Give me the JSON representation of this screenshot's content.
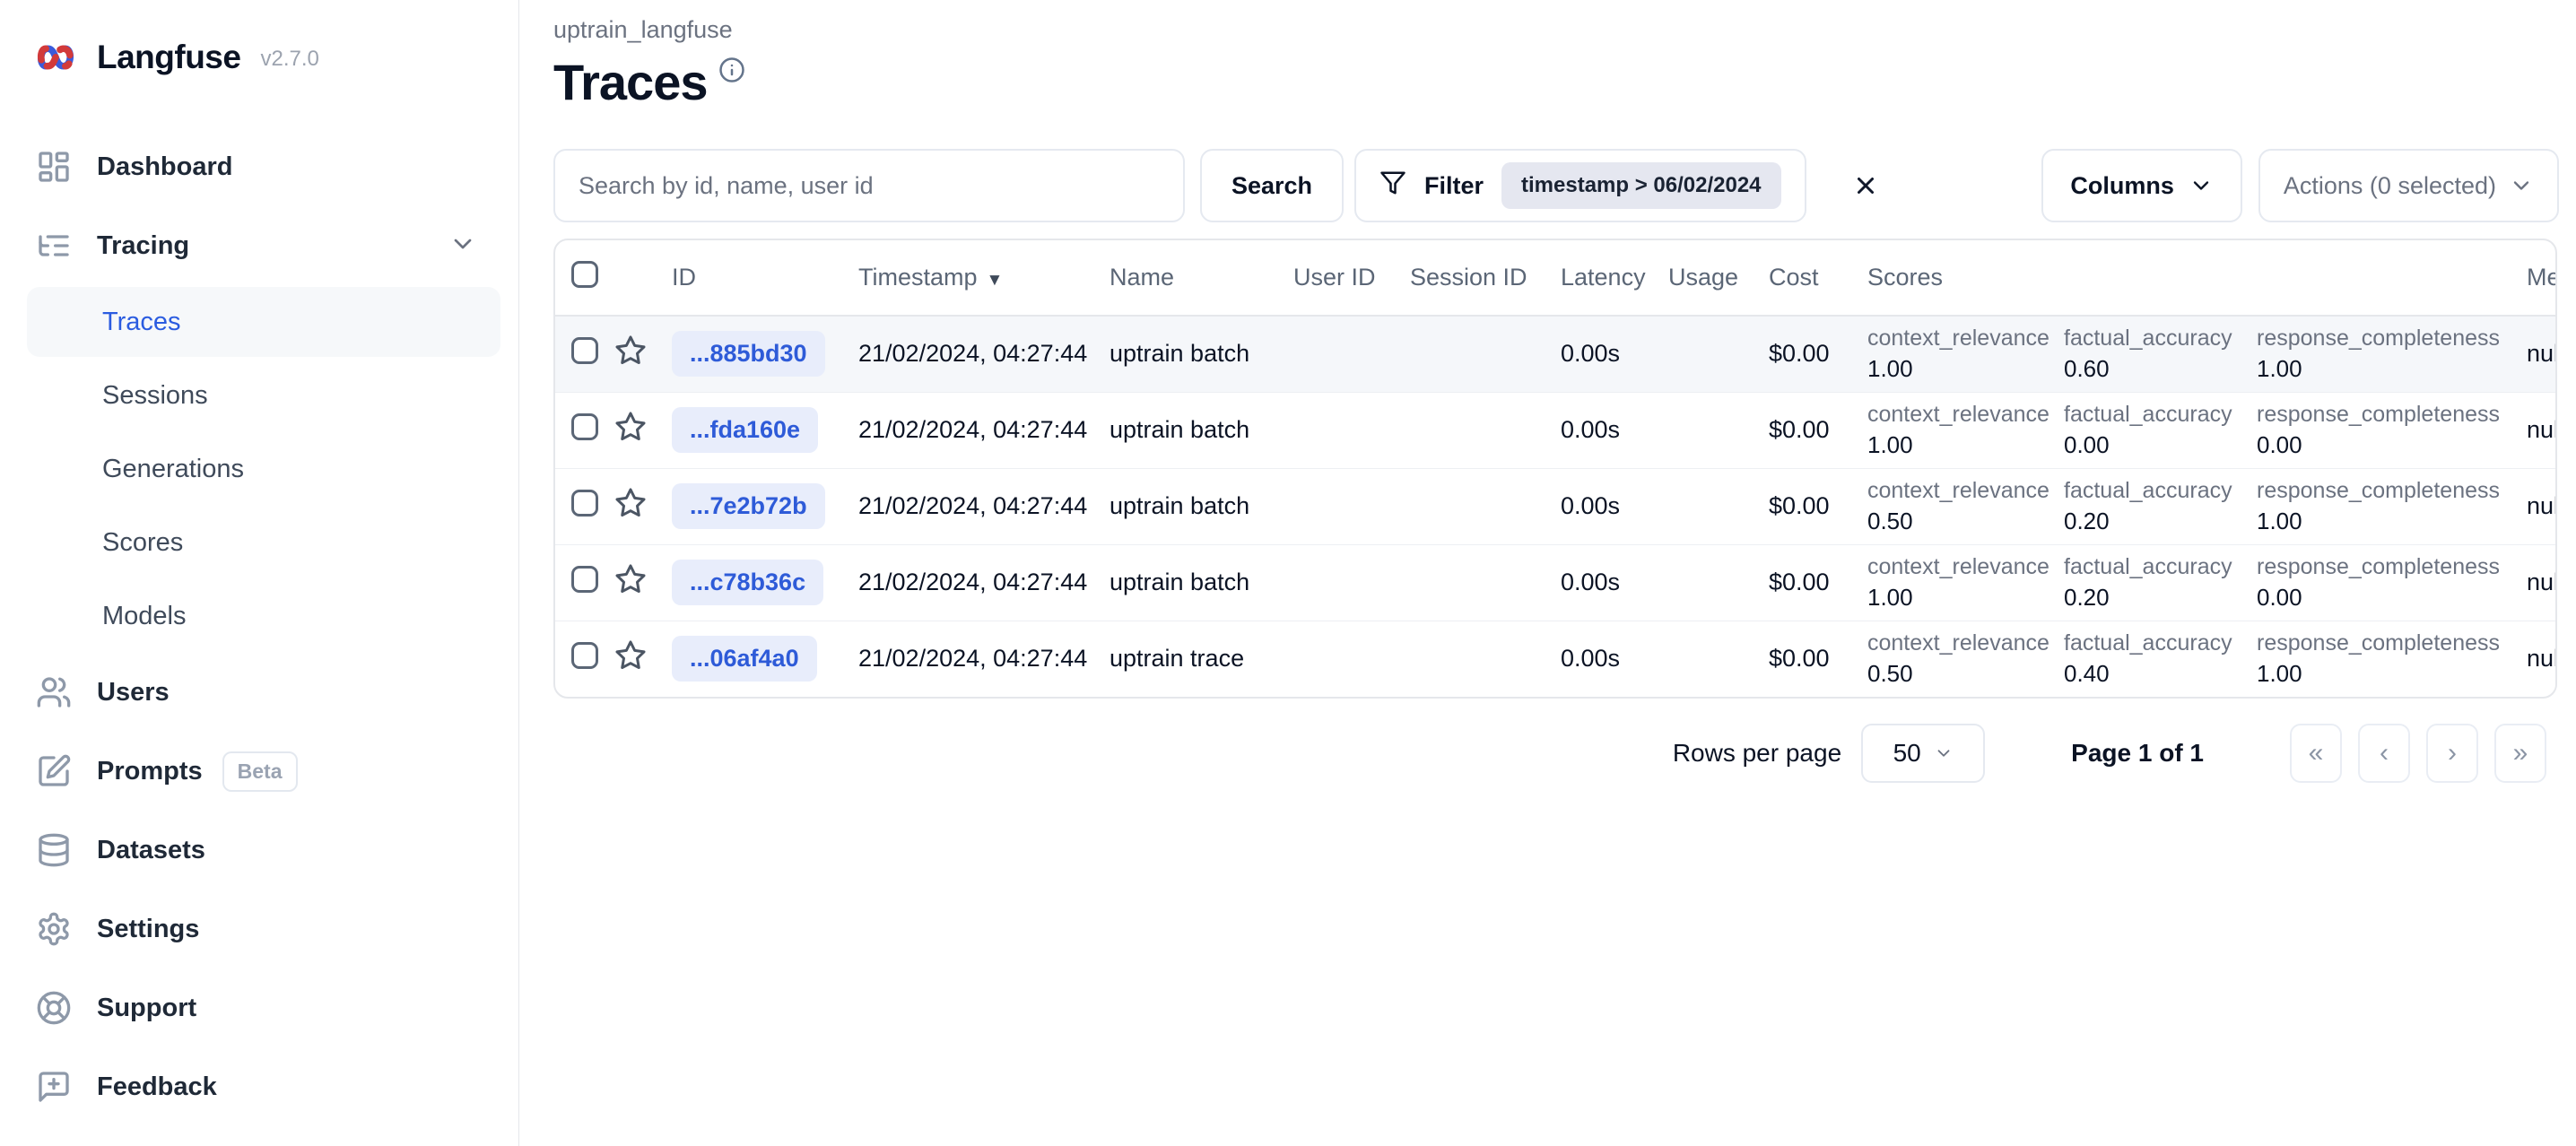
{
  "app": {
    "brand": "Langfuse",
    "version": "v2.7.0"
  },
  "icons": {
    "logo": "knot-icon",
    "dashboard": "grid-icon",
    "tracing": "list-tree-icon",
    "users": "users-icon",
    "prompts": "edit-icon",
    "datasets": "database-icon",
    "settings": "gear-icon",
    "support": "life-buoy-icon",
    "feedback": "message-plus-icon",
    "filter": "funnel-icon",
    "clear": "x-icon",
    "expand": "chevron-down-icon",
    "sort": "triangle-down-icon",
    "favorite": "star-icon",
    "info": "info-icon"
  },
  "sidebar": {
    "items": [
      {
        "label": "Dashboard",
        "type": "item"
      },
      {
        "label": "Tracing",
        "type": "item",
        "chevron": true
      },
      {
        "label": "Traces",
        "type": "sub",
        "active": true
      },
      {
        "label": "Sessions",
        "type": "sub"
      },
      {
        "label": "Generations",
        "type": "sub"
      },
      {
        "label": "Scores",
        "type": "sub"
      },
      {
        "label": "Models",
        "type": "sub"
      },
      {
        "label": "Users",
        "type": "item"
      },
      {
        "label": "Prompts",
        "type": "item",
        "badge": "Beta"
      },
      {
        "label": "Datasets",
        "type": "item"
      },
      {
        "label": "Settings",
        "type": "item"
      },
      {
        "label": "Support",
        "type": "item"
      },
      {
        "label": "Feedback",
        "type": "item"
      }
    ]
  },
  "header": {
    "project": "uptrain_langfuse",
    "title": "Traces"
  },
  "toolbar": {
    "search_placeholder": "Search by id, name, user id",
    "search_button": "Search",
    "filter_label": "Filter",
    "filter_chip": "timestamp > 06/02/2024",
    "columns_label": "Columns",
    "actions_label": "Actions (0 selected)"
  },
  "table": {
    "columns": [
      "ID",
      "Timestamp",
      "Name",
      "User ID",
      "Session ID",
      "Latency",
      "Usage",
      "Cost",
      "Scores",
      "Metadata"
    ],
    "sorted_column": "Timestamp",
    "sort_indicator": "▼",
    "rows": [
      {
        "id": "...885bd30",
        "timestamp": "21/02/2024, 04:27:44",
        "name": "uptrain batch",
        "user_id": "",
        "session_id": "",
        "latency": "0.00s",
        "usage": "",
        "cost": "$0.00",
        "scores": [
          {
            "name": "context_relevance",
            "value": "1.00"
          },
          {
            "name": "factual_accuracy",
            "value": "0.60"
          },
          {
            "name": "response_completeness",
            "value": "1.00"
          }
        ],
        "metadata": "null"
      },
      {
        "id": "...fda160e",
        "timestamp": "21/02/2024, 04:27:44",
        "name": "uptrain batch",
        "user_id": "",
        "session_id": "",
        "latency": "0.00s",
        "usage": "",
        "cost": "$0.00",
        "scores": [
          {
            "name": "context_relevance",
            "value": "1.00"
          },
          {
            "name": "factual_accuracy",
            "value": "0.00"
          },
          {
            "name": "response_completeness",
            "value": "0.00"
          }
        ],
        "metadata": "null"
      },
      {
        "id": "...7e2b72b",
        "timestamp": "21/02/2024, 04:27:44",
        "name": "uptrain batch",
        "user_id": "",
        "session_id": "",
        "latency": "0.00s",
        "usage": "",
        "cost": "$0.00",
        "scores": [
          {
            "name": "context_relevance",
            "value": "0.50"
          },
          {
            "name": "factual_accuracy",
            "value": "0.20"
          },
          {
            "name": "response_completeness",
            "value": "1.00"
          }
        ],
        "metadata": "null"
      },
      {
        "id": "...c78b36c",
        "timestamp": "21/02/2024, 04:27:44",
        "name": "uptrain batch",
        "user_id": "",
        "session_id": "",
        "latency": "0.00s",
        "usage": "",
        "cost": "$0.00",
        "scores": [
          {
            "name": "context_relevance",
            "value": "1.00"
          },
          {
            "name": "factual_accuracy",
            "value": "0.20"
          },
          {
            "name": "response_completeness",
            "value": "0.00"
          }
        ],
        "metadata": "null"
      },
      {
        "id": "...06af4a0",
        "timestamp": "21/02/2024, 04:27:44",
        "name": "uptrain trace",
        "user_id": "",
        "session_id": "",
        "latency": "0.00s",
        "usage": "",
        "cost": "$0.00",
        "scores": [
          {
            "name": "context_relevance",
            "value": "0.50"
          },
          {
            "name": "factual_accuracy",
            "value": "0.40"
          },
          {
            "name": "response_completeness",
            "value": "1.00"
          }
        ],
        "metadata": "null"
      }
    ]
  },
  "pagination": {
    "rows_per_page_label": "Rows per page",
    "rows_per_page_value": "50",
    "page_label": "Page 1 of 1",
    "first": "«",
    "prev": "‹",
    "next": "›",
    "last": "»"
  }
}
